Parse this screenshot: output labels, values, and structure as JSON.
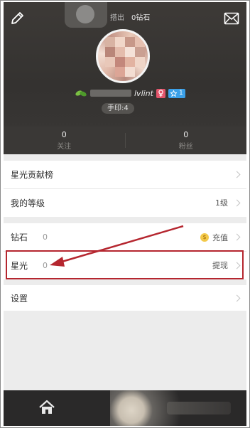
{
  "header": {
    "top_left_text": "搭出",
    "top_right_text": "0钻石",
    "name_suffix": "lvlint",
    "level_badge": "1",
    "id_text": "手印:4"
  },
  "stats": [
    {
      "num": "0",
      "label": "关注"
    },
    {
      "num": "0",
      "label": "粉丝"
    }
  ],
  "menu": {
    "contrib": {
      "label": "星光贡献榜"
    },
    "level": {
      "label": "我的等级",
      "value": "1级"
    },
    "diamond": {
      "label": "钻石",
      "count": "0",
      "action": "充值",
      "coin_symbol": "$"
    },
    "starlight": {
      "label": "星光",
      "count": "0",
      "action": "提现"
    },
    "settings": {
      "label": "设置"
    }
  },
  "annotation": {
    "color": "#b5262f"
  },
  "colors": {
    "header_bg": "#343230",
    "accent_red": "#b5262f",
    "coin": "#f3c94a"
  }
}
